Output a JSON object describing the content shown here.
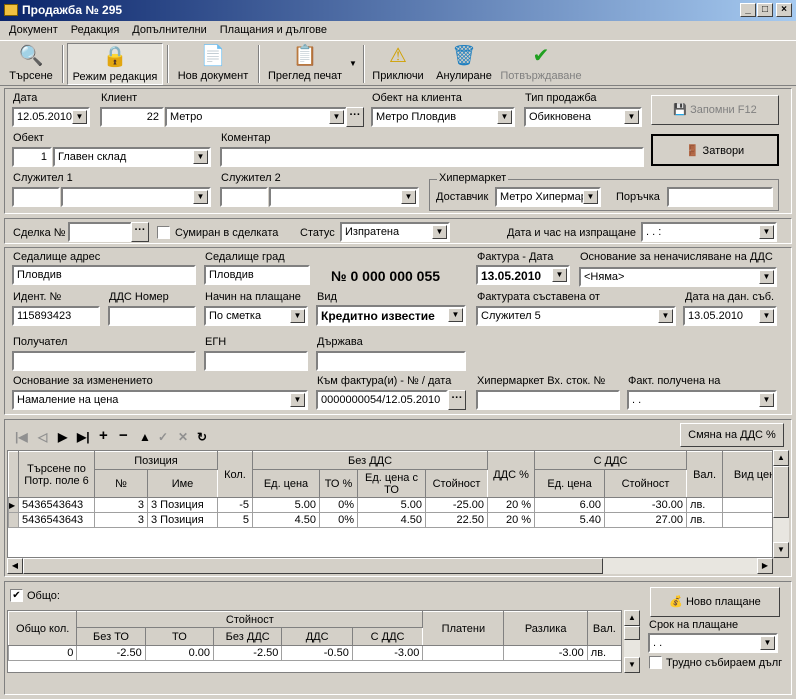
{
  "window": {
    "title": "Продажба № 295"
  },
  "menu": [
    "Документ",
    "Редакция",
    "Допълнителни",
    "Плащания и дългове"
  ],
  "toolbar": {
    "search": "Търсене",
    "edit_mode": "Режим редакция",
    "new_doc": "Нов документ",
    "preview": "Преглед печат",
    "finish": "Приключи",
    "annul": "Анулиране",
    "confirm": "Потвърждаване"
  },
  "header": {
    "date_label": "Дата",
    "date": "12.05.2010",
    "client_label": "Клиент",
    "client_code": "22",
    "client_name": "Метро",
    "client_obj_label": "Обект на клиента",
    "client_obj": "Метро Пловдив",
    "sale_type_label": "Тип продажба",
    "sale_type": "Обикновена",
    "save_btn": "Запомни  F12",
    "close_btn": "Затвори",
    "obj_label": "Обект",
    "obj_code": "1",
    "obj_name": "Главен склад",
    "comment_label": "Коментар",
    "comment": "",
    "emp1_label": "Служител 1",
    "emp2_label": "Служител 2",
    "hyper_label": "Хипермаркет",
    "supplier_label": "Доставчик",
    "supplier": "Метро Хипермар",
    "order_label": "Поръчка"
  },
  "deal": {
    "deal_label": "Сделка №",
    "summed_label": "Сумиран в сделката",
    "status_label": "Статус",
    "status": "Изпратена",
    "sent_label": "Дата и час на изпращане",
    "sent_value": " .  .        :"
  },
  "invoice": {
    "addr_label": "Седалище адрес",
    "addr": "Пловдив",
    "city_label": "Седалище град",
    "city": "Пловдив",
    "number": "№ 0 000 000 055",
    "inv_date_label": "Фактура - Дата",
    "inv_date": "13.05.2010",
    "vat_basis_label": "Основание за неначисляване на ДДС",
    "vat_basis": "<Няма>",
    "id_label": "Идент. №",
    "id": "115893423",
    "vat_no_label": "ДДС Номер",
    "vat_no": "",
    "pay_label": "Начин на плащане",
    "pay": "По сметка",
    "kind_label": "Вид",
    "kind": "Кредитно известие",
    "made_by_label": "Фактурата съставена от",
    "made_by": "Служител 5",
    "tax_date_label": "Дата на дан. съб.",
    "tax_date": "13.05.2010",
    "recipient_label": "Получател",
    "egn_label": "ЕГН",
    "country_label": "Държава",
    "change_label": "Основание за изменението",
    "change": "Намаление на цена",
    "to_inv_label": "Към фактура(и) - № / дата",
    "to_inv": "0000000054/12.05.2010",
    "hyper_in_label": "Хипермаркет Вх. сток. №",
    "received_label": "Факт. получена на",
    "received": " .  ."
  },
  "grid": {
    "vat_change_btn": "Смяна на ДДС %",
    "h": {
      "search": "Търсене по Потр. поле 6",
      "position": "Позиция",
      "no": "№",
      "name": "Име",
      "qty": "Кол.",
      "no_vat": "Без ДДС",
      "unit_price": "Ед. цена",
      "to_pct": "ТО %",
      "unit_to": "Ед. цена с ТО",
      "value": "Стойност",
      "vat_pct": "ДДС %",
      "with_vat": "С ДДС",
      "unit_price2": "Ед. цена",
      "value2": "Стойност",
      "cur": "Вал.",
      "price_type": "Вид цена"
    },
    "rows": [
      {
        "code": "5436543643",
        "no": "3",
        "name": "3 Позиция",
        "qty": "-5",
        "price": "5.00",
        "to": "0%",
        "price_to": "5.00",
        "value": "-25.00",
        "vat": "20 %",
        "price_vat": "6.00",
        "value_vat": "-30.00",
        "cur": "лв."
      },
      {
        "code": "5436543643",
        "no": "3",
        "name": "3 Позиция",
        "qty": "5",
        "price": "4.50",
        "to": "0%",
        "price_to": "4.50",
        "value": "22.50",
        "vat": "20 %",
        "price_vat": "5.40",
        "value_vat": "27.00",
        "cur": "лв."
      }
    ]
  },
  "totals": {
    "total_label": "Общо:",
    "new_pay_btn": "Ново плащане",
    "h": {
      "qty": "Общо кол.",
      "value": "Стойност",
      "no_to": "Без ТО",
      "to": "ТО",
      "no_vat": "Без ДДС",
      "vat": "ДДС",
      "with_vat": "С ДДС",
      "paid": "Платени",
      "diff": "Разлика",
      "cur": "Вал."
    },
    "row": {
      "qty": "0",
      "no_to": "-2.50",
      "to": "0.00",
      "no_vat": "-2.50",
      "vat": "-0.50",
      "with_vat": "-3.00",
      "paid": "",
      "diff": "-3.00",
      "cur": "лв."
    },
    "term_label": "Срок на плащане",
    "term": " .  .",
    "hard_debt_label": "Трудно събираем дълг"
  }
}
